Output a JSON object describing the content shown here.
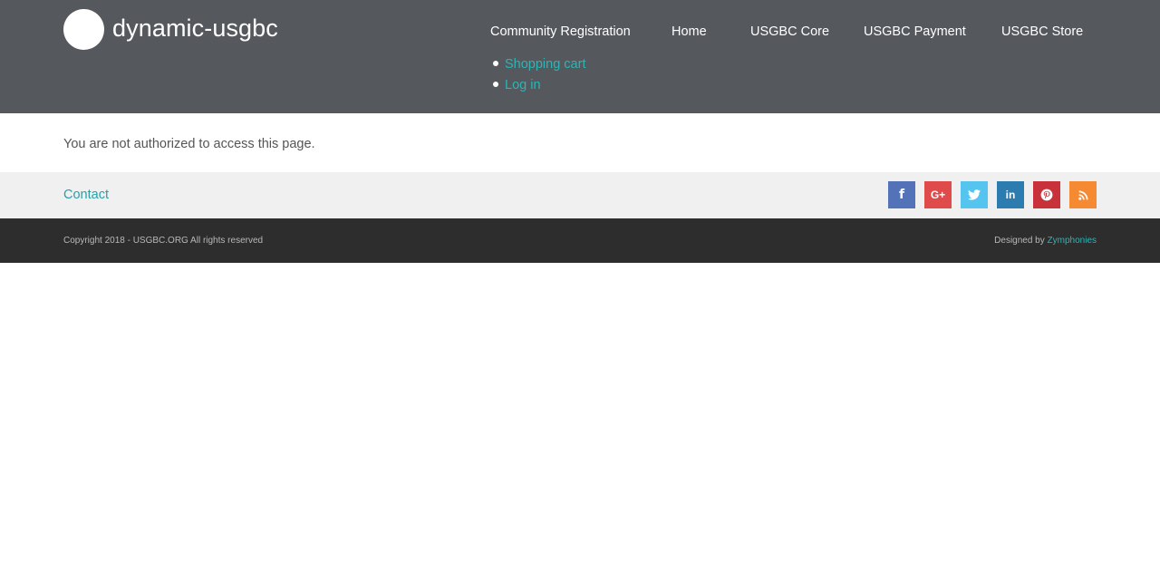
{
  "header": {
    "site_name": "dynamic-usgbc",
    "logo_icon": "white-circle-logo",
    "background": "#55585d"
  },
  "main_nav": {
    "items": [
      {
        "label": "Community Registration"
      },
      {
        "label": "Home"
      },
      {
        "label": "USGBC Core"
      },
      {
        "label": "USGBC Payment"
      },
      {
        "label": "USGBC Store"
      }
    ]
  },
  "user_menu": {
    "items": [
      {
        "label": "Shopping cart"
      },
      {
        "label": "Log in"
      }
    ]
  },
  "content": {
    "message": "You are not authorized to access this page."
  },
  "footer": {
    "contact_label": "Contact",
    "social": [
      {
        "icon": "facebook-icon",
        "glyph": "f",
        "color": "#5472b8"
      },
      {
        "icon": "google-plus-icon",
        "glyph": "G+",
        "color": "#df4a4a"
      },
      {
        "icon": "twitter-icon",
        "glyph": "t",
        "color": "#55c5ef"
      },
      {
        "icon": "linkedin-icon",
        "glyph": "in",
        "color": "#2d7cb0"
      },
      {
        "icon": "pinterest-icon",
        "glyph": "p",
        "color": "#c8303a"
      },
      {
        "icon": "rss-icon",
        "glyph": "rss",
        "color": "#f58a32"
      }
    ],
    "copyright": "Copyright 2018 - USGBC.ORG All rights reserved",
    "designed_by_prefix": "Designed by",
    "designed_by_link": "Zymphonies"
  }
}
